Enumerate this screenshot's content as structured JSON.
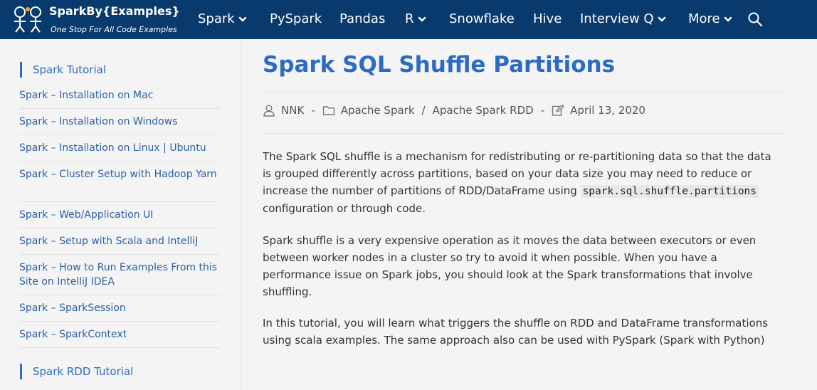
{
  "brand": {
    "title": "SparkBy{Examples}",
    "tagline": "One Stop For All Code Examples"
  },
  "nav": {
    "spark": "Spark",
    "pyspark": "PySpark",
    "pandas": "Pandas",
    "r": "R",
    "snowflake": "Snowflake",
    "hive": "Hive",
    "interview": "Interview Q",
    "more": "More"
  },
  "sidebar": {
    "heading_spark": "Spark Tutorial",
    "heading_rdd": "Spark RDD Tutorial",
    "links": [
      "Spark – Installation on Mac",
      "Spark – Installation on Windows",
      "Spark – Installation on Linux | Ubuntu",
      "Spark – Cluster Setup with Hadoop Yarn",
      "Spark – Web/Application UI",
      "Spark – Setup with Scala and IntelliJ",
      "Spark – How to Run Examples From this Site on IntelliJ IDEA",
      "Spark – SparkSession",
      "Spark – SparkContext"
    ]
  },
  "article": {
    "title": "Spark SQL Shuffle Partitions",
    "meta": {
      "author": "NNK",
      "dash1": "-",
      "category1": "Apache Spark",
      "slash": "/",
      "category2": "Apache Spark RDD",
      "dash2": "-",
      "date": "April 13, 2020"
    },
    "p1_text": "The Spark SQL shuffle is a mechanism for redistributing or re-partitioning data so that the data is grouped differently across partitions, based on your data size you may need to reduce or increase the number of partitions of RDD/DataFrame using ",
    "p1_code": "spark.sql.shuffle.partitions",
    "p1_tail": " configuration or through code.",
    "p2": "Spark shuffle is a very expensive operation as it moves the data between executors or even between worker nodes in a cluster so try to avoid it when possible. When you have a performance issue on Spark jobs, you should look at the Spark transformations that involve shuffling.",
    "p3": "In this tutorial, you will learn what triggers the shuffle on RDD and DataFrame transformations using scala examples. The same approach also can be used with PySpark (Spark with Python)"
  },
  "colors": {
    "header": "#093a6e",
    "accent": "#2c6bc4",
    "background": "#f4f4f4"
  },
  "icons": [
    "logo-mark",
    "chevron-down-icon",
    "search-icon",
    "user-icon",
    "folder-icon",
    "edit-icon"
  ]
}
